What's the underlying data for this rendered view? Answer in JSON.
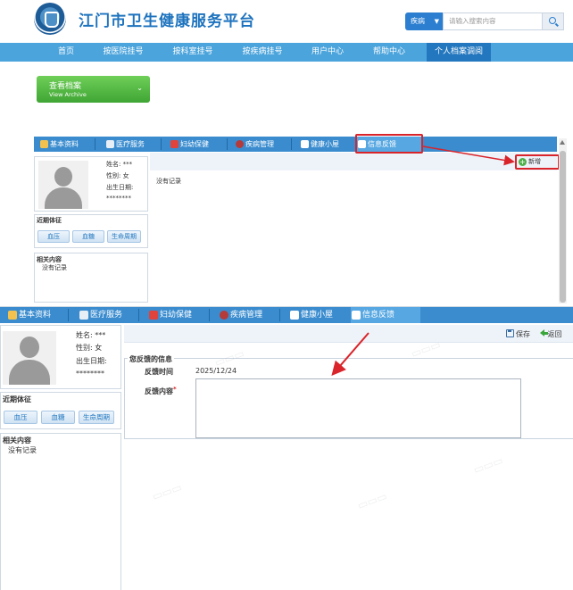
{
  "site": {
    "title": "江门市卫生健康服务平台",
    "search_category": "疾病",
    "search_placeholder": "请输入搜索内容"
  },
  "nav": {
    "items": [
      "首页",
      "按医院挂号",
      "按科室挂号",
      "按疾病挂号",
      "用户中心",
      "帮助中心",
      "个人档案调阅"
    ],
    "active_index": 6
  },
  "archive": {
    "title": "查看档案",
    "subtitle": "View Archive"
  },
  "tabs": {
    "items": [
      {
        "label": "基本资料",
        "icon": "document-icon"
      },
      {
        "label": "医疗服务",
        "icon": "doctor-icon"
      },
      {
        "label": "妇幼保健",
        "icon": "maternal-icon"
      },
      {
        "label": "疾病管理",
        "icon": "disease-icon"
      },
      {
        "label": "健康小屋",
        "icon": "house-icon"
      },
      {
        "label": "信息反馈",
        "icon": "feedback-house-icon"
      }
    ],
    "active_index": 5
  },
  "profile": {
    "name_label": "姓名:",
    "name_value": "***",
    "gender_label": "性别:",
    "gender_value": "女",
    "dob_label": "出生日期:",
    "dob_value": "********"
  },
  "vitals": {
    "title": "近期体征",
    "buttons": [
      "血压",
      "血糖",
      "生命周期"
    ]
  },
  "related": {
    "title": "相关内容",
    "empty_text": "没有记录"
  },
  "feedback_list": {
    "add_label": "新增",
    "empty_text": "没有记录"
  },
  "feedback_form": {
    "save_label": "保存",
    "back_label": "返回",
    "section_title": "您反馈的信息",
    "time_label": "反馈时间",
    "time_value": "2025/12/24",
    "content_label": "反馈内容",
    "required_mark": "*",
    "content_value": ""
  },
  "colors": {
    "brand_blue": "#1e73be",
    "nav_bg": "#4ba4dc",
    "tab_bg": "#3a8ccf",
    "archive_green": "#3fa534",
    "annotation_red": "#d9242b"
  }
}
